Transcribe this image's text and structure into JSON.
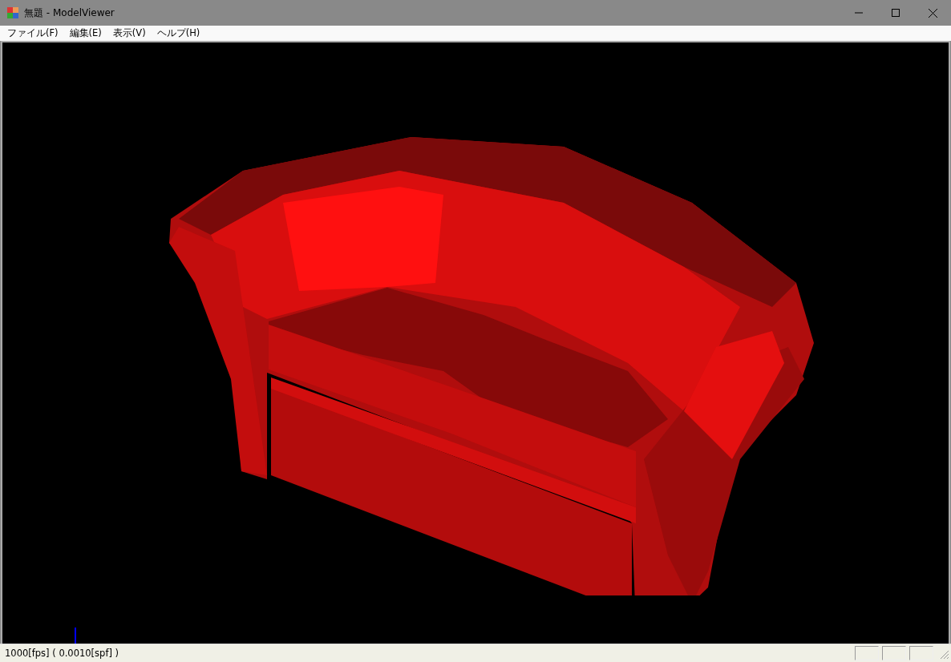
{
  "window": {
    "title": "無題 - ModelViewer"
  },
  "menu": [
    {
      "label": "ファイル(F)"
    },
    {
      "label": "編集(E)"
    },
    {
      "label": "表示(V)"
    },
    {
      "label": "ヘルプ(H)"
    }
  ],
  "status_bar": {
    "text": "1000[fps] ( 0.0010[spf] )"
  }
}
